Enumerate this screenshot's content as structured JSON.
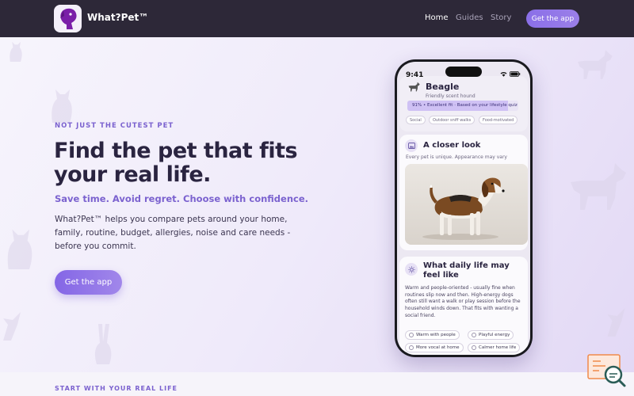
{
  "header": {
    "brand": "What?Pet™",
    "nav": [
      {
        "label": "Home",
        "active": true
      },
      {
        "label": "Guides",
        "active": false
      },
      {
        "label": "Story",
        "active": false
      }
    ],
    "cta": "Get the app"
  },
  "hero": {
    "eyebrow": "NOT JUST THE CUTEST PET",
    "headline": "Find the pet that fits your real life.",
    "subline": "Save time. Avoid regret. Choose with confidence.",
    "body": "What?Pet™ helps you compare pets around your home, family, routine, budget, allergies, noise and care needs - before you commit.",
    "cta": "Get the app"
  },
  "section_label": "START WITH YOUR REAL LIFE",
  "phone": {
    "time": "9:41",
    "pet_name": "Beagle",
    "pet_sub": "Friendly scent hound",
    "fit_label": "91% • Excellent fit · Based on your lifestyle quiz",
    "fit_value": 0.91,
    "tags": [
      "Social",
      "Outdoor sniff walks",
      "Food-motivated"
    ],
    "closer_look": {
      "title": "A closer look",
      "subtitle": "Every pet is unique. Appearance may vary"
    },
    "daily_life": {
      "title": "What daily life may feel like",
      "description": "Warm and people-oriented - usually fine when routines slip now and then. High-energy dogs often still want a walk or play session before the household winds down. That fits with wanting a social friend.",
      "chips": [
        "Warm with people",
        "Playful energy",
        "More vocal at home",
        "Calmer home life"
      ]
    }
  },
  "colors": {
    "accent": "#7b62cf",
    "header_bg": "#2d2838",
    "button": "#8a6fe8"
  }
}
